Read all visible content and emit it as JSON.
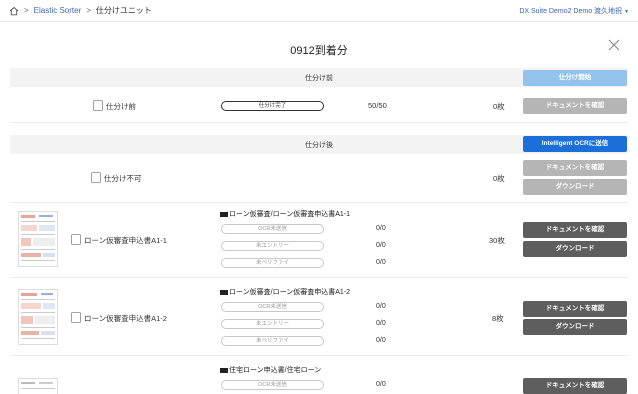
{
  "breadcrumb": {
    "home": "home-icon",
    "items": [
      "Elastic Sorter",
      "仕分けユニット"
    ],
    "separator": ">"
  },
  "account": {
    "label": "DX Suite Demo2 Demo 渡久地祝",
    "caret": "▼"
  },
  "page": {
    "title": "0912到着分"
  },
  "before": {
    "header": "仕分け前",
    "start_button": "仕分け開始",
    "row": {
      "label": "仕分け前",
      "status_pill": "仕分け完了",
      "progress": "50/50",
      "count": "0枚",
      "check_button": "ドキュメントを確認"
    }
  },
  "after": {
    "header": "仕分け後",
    "send_button": "Intelligent OCRに送信",
    "unclassified": {
      "label": "仕分け不可",
      "count": "0枚",
      "check_button": "ドキュメントを確認",
      "download_button": "ダウンロード"
    },
    "groups": [
      {
        "label": "ローン仮審査申込書A1-1",
        "category": "ローン仮審査/ローン仮審査申込書A1-1",
        "statuses": [
          {
            "label": "OCR未送信",
            "value": "0/0"
          },
          {
            "label": "未エントリー",
            "value": "0/0"
          },
          {
            "label": "未ベリファイ",
            "value": "0/0"
          }
        ],
        "count": "30枚",
        "check_button": "ドキュメントを確認",
        "download_button": "ダウンロード"
      },
      {
        "label": "ローン仮審査申込書A1-2",
        "category": "ローン仮審査/ローン仮審査申込書A1-2",
        "statuses": [
          {
            "label": "OCR未送信",
            "value": "0/0"
          },
          {
            "label": "未エントリー",
            "value": "0/0"
          },
          {
            "label": "未ベリファイ",
            "value": "0/0"
          }
        ],
        "count": "8枚",
        "check_button": "ドキュメントを確認",
        "download_button": "ダウンロード"
      },
      {
        "category": "住宅ローン申込書/住宅ローン",
        "statuses": [
          {
            "label": "OCR未送信",
            "value": "0/0"
          }
        ],
        "check_button": "ドキュメントを確認"
      }
    ]
  },
  "colors": {
    "link": "#3c64b4",
    "primary": "#1c6fd9",
    "primary_light": "#93c3ec",
    "dark_button": "#5e5e5e",
    "disabled_button": "#b5b5b5"
  }
}
